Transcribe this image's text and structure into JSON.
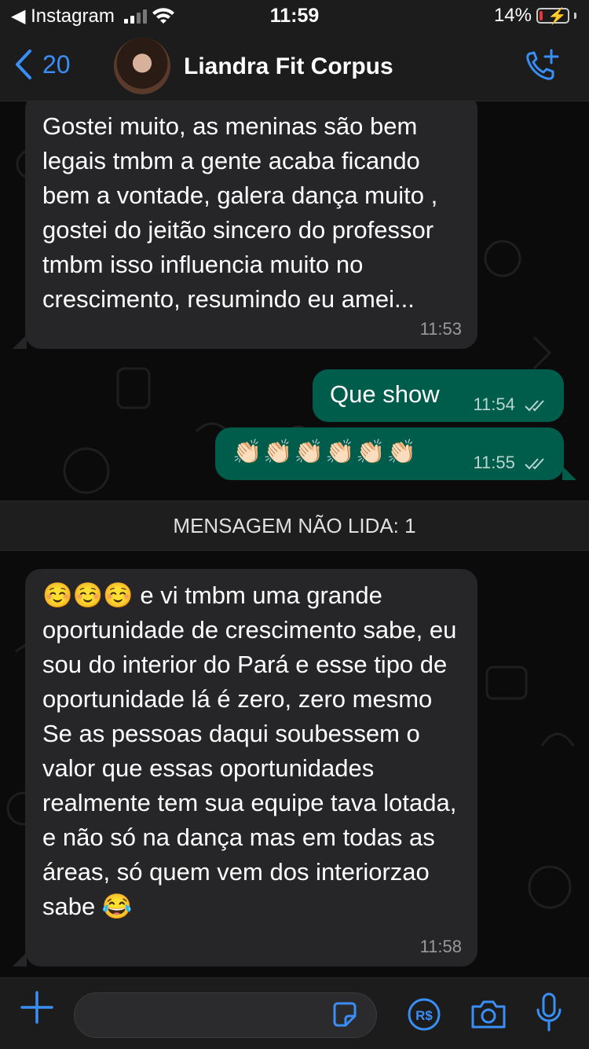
{
  "status_bar": {
    "back_app": "◀ Instagram",
    "time": "11:59",
    "battery": "14%"
  },
  "nav": {
    "back_count": "20",
    "contact_name": "Liandra Fit Corpus"
  },
  "messages": [
    {
      "direction": "in",
      "text": "Gostei muito, as meninas são bem legais tmbm a gente acaba ficando bem a vontade, galera dança muito , gostei do jeitão sincero do professor tmbm isso influencia muito no crescimento, resumindo eu amei...",
      "time": "11:53"
    },
    {
      "direction": "out",
      "text": "Que show",
      "time": "11:54"
    },
    {
      "direction": "out",
      "text": "👏🏻👏🏻👏🏻👏🏻👏🏻👏🏻",
      "time": "11:55"
    },
    {
      "direction": "in",
      "text": "☺️☺️☺️ e vi tmbm uma grande oportunidade de crescimento sabe, eu sou do interior do Pará e esse tipo de oportunidade lá é zero, zero mesmo\nSe as pessoas daqui soubessem o valor que essas oportunidades realmente tem sua equipe tava lotada, e não só na dança mas em todas as áreas, só quem vem dos interiorzao sabe 😂",
      "time": "11:58"
    }
  ],
  "unread_banner": "MENSAGEM NÃO LIDA: 1",
  "input": {
    "placeholder": ""
  },
  "icons": [
    "back-chevron-icon",
    "avatar",
    "video-call-add-icon",
    "plus-icon",
    "sticker-icon",
    "pay-icon",
    "camera-icon",
    "mic-icon"
  ],
  "colors": {
    "accent": "#3a8ff7",
    "outgoing_bubble": "#005c4b",
    "incoming_bubble": "#262628",
    "background": "#0b0b0b"
  }
}
